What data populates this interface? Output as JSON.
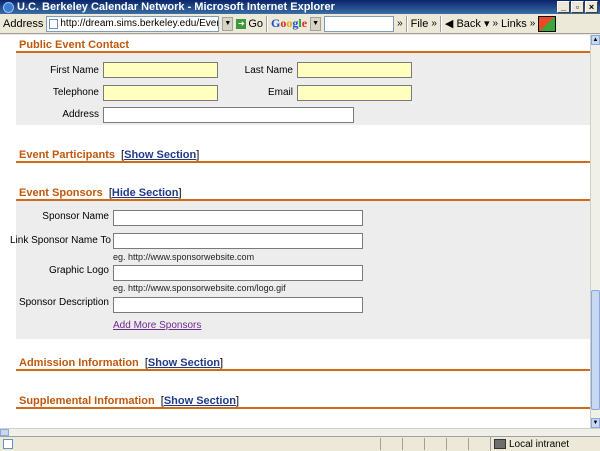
{
  "window": {
    "title": "U.C. Berkeley Calendar Network - Microsoft Internet Explorer"
  },
  "toolbar": {
    "address_label": "Address",
    "address_url": "http://dream.sims.berkeley.edu/EventCalenda",
    "go_label": "Go",
    "google_letters": [
      "G",
      "o",
      "o",
      "g",
      "l",
      "e"
    ],
    "file_label": "File",
    "back_label": "Back",
    "links_label": "Links",
    "chevron": "»"
  },
  "sections": {
    "contact": {
      "title": "Public Event Contact",
      "fields": {
        "first_name": "First Name",
        "last_name": "Last Name",
        "telephone": "Telephone",
        "email": "Email",
        "address": "Address"
      }
    },
    "participants": {
      "title": "Event Participants",
      "toggle": "Show Section"
    },
    "sponsors": {
      "title": "Event Sponsors",
      "toggle": "Hide Section",
      "fields": {
        "sponsor_name": "Sponsor Name",
        "link_sponsor": "Link Sponsor Name To",
        "link_hint": "eg. http://www.sponsorwebsite.com",
        "graphic_logo": "Graphic Logo",
        "logo_hint": "eg. http://www.sponsorwebsite.com/logo.gif",
        "sponsor_description": "Sponsor Description"
      },
      "add_more": "Add More Sponsors"
    },
    "admission": {
      "title": "Admission Information",
      "toggle": "Show Section"
    },
    "supplemental": {
      "title": "Supplemental Information",
      "toggle": "Show Section"
    }
  },
  "statusbar": {
    "zone": "Local intranet"
  },
  "colors": {
    "section_title": "#c0580c",
    "rule": "#d06a18",
    "field_highlight": "#ffffc0",
    "panel": "#ededed"
  }
}
